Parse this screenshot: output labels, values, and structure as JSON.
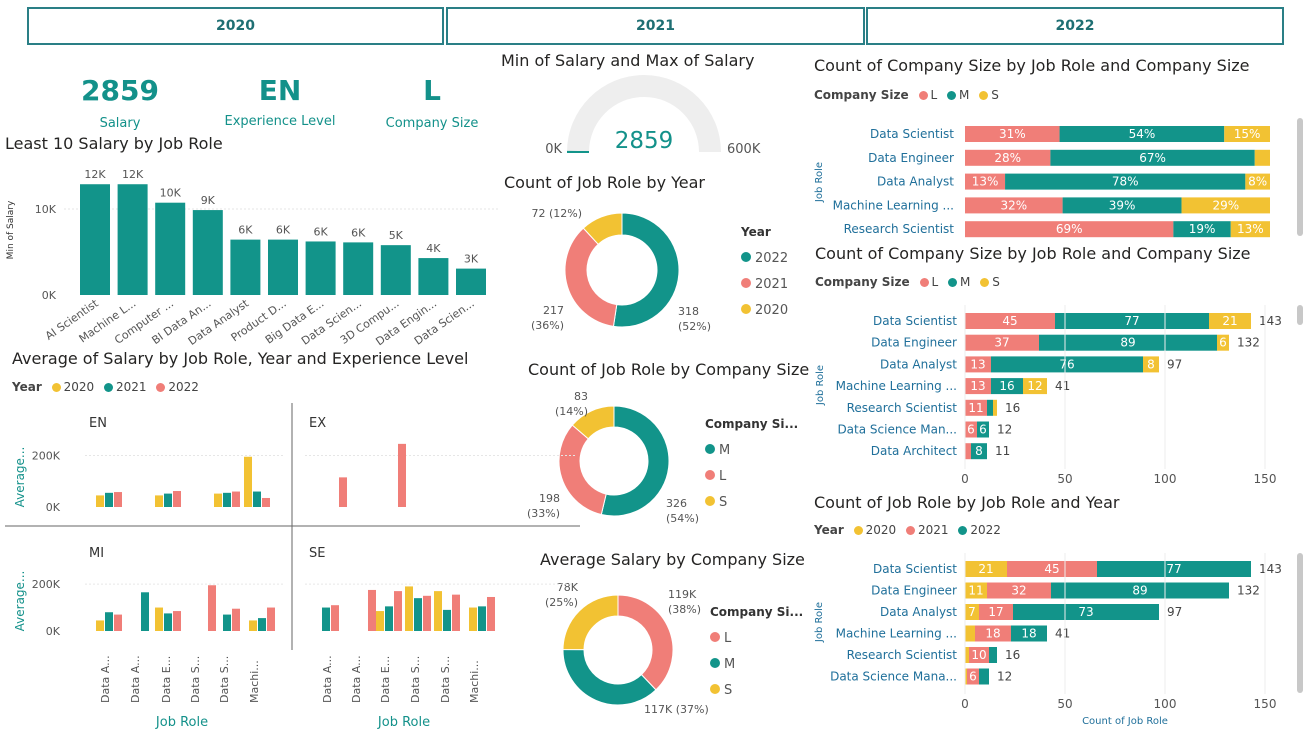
{
  "slicer": {
    "years": [
      "2020",
      "2021",
      "2022"
    ]
  },
  "colors": {
    "teal": "#12948a",
    "salmon": "#f07e78",
    "yellow": "#f2c233"
  },
  "cards": [
    {
      "value": "2859",
      "label": "Salary"
    },
    {
      "value": "EN",
      "label": "Experience Level"
    },
    {
      "value": "L",
      "label": "Company Size"
    }
  ],
  "charts": {
    "least10": {
      "title": "Least 10 Salary by Job Role",
      "ylabel": "Min of Salary"
    },
    "gauge": {
      "title": "Min of Salary and Max of Salary",
      "value": "2859",
      "min": "0K",
      "max": "600K"
    },
    "donut_year": {
      "title": "Count of Job Role by Year",
      "legend_title": "Year"
    },
    "donut_size": {
      "title": "Count of Job Role by Company Size",
      "legend_title": "Company Si..."
    },
    "donut_avg": {
      "title": "Average Salary by Company Size",
      "legend_title": "Company Si..."
    },
    "avg_matrix": {
      "title": "Average of Salary by Job Role, Year and Experience Level",
      "legend_title": "Year",
      "xlabel": "Job Role",
      "ylabel": "Average..."
    },
    "stack100": {
      "title": "Count of Company Size by Job Role and Company Size",
      "legend_title": "Company Size",
      "ylabel": "Job Role"
    },
    "stack_count": {
      "title": "Count of Company Size by Job Role and Company Size",
      "legend_title": "Company Size",
      "ylabel": "Job Role"
    },
    "stack_year": {
      "title": "Count of Job Role by Job Role and Year",
      "legend_title": "Year",
      "ylabel": "Job Role",
      "xlabel": "Count of Job Role"
    }
  },
  "chart_data": [
    {
      "type": "bar",
      "id": "least10",
      "title": "Least 10 Salary by Job Role",
      "ylabel": "Min of Salary",
      "ylim": [
        0,
        13000
      ],
      "yticks": [
        "0K",
        "10K"
      ],
      "categories": [
        "AI Scientist",
        "Machine L...",
        "Computer ...",
        "BI Data An...",
        "Data Analyst",
        "Product D...",
        "Big Data E...",
        "Data Scien...",
        "3D Compu...",
        "Data Engin...",
        "Data Scien..."
      ],
      "values": [
        12000,
        12000,
        10000,
        9200,
        6000,
        6000,
        5800,
        5700,
        5400,
        4000,
        2859
      ],
      "labels": [
        "12K",
        "12K",
        "10K",
        "9K",
        "6K",
        "6K",
        "6K",
        "6K",
        "5K",
        "4K",
        "3K"
      ]
    },
    {
      "type": "gauge",
      "id": "gauge",
      "value": 2859,
      "min": 0,
      "max": 600000
    },
    {
      "type": "pie",
      "id": "donut_year",
      "categories": [
        "2022",
        "2021",
        "2020"
      ],
      "values": [
        318,
        217,
        72
      ],
      "labels": [
        "318\n(52%)",
        "217\n(36%)",
        "72 (12%)"
      ]
    },
    {
      "type": "pie",
      "id": "donut_size",
      "categories": [
        "M",
        "L",
        "S"
      ],
      "values": [
        326,
        198,
        83
      ],
      "labels": [
        "326\n(54%)",
        "198\n(33%)",
        "83\n(14%)"
      ]
    },
    {
      "type": "pie",
      "id": "donut_avg",
      "categories": [
        "L",
        "M",
        "S"
      ],
      "values": [
        119,
        117,
        78
      ],
      "labels": [
        "119K\n(38%)",
        "117K (37%)",
        "78K\n(25%)"
      ]
    },
    {
      "type": "bar",
      "id": "stack100",
      "orientation": "horizontal",
      "stacked": "percent",
      "series_names": [
        "L",
        "M",
        "S"
      ],
      "categories": [
        "Data Scientist",
        "Data Engineer",
        "Data Analyst",
        "Machine Learning ...",
        "Research Scientist"
      ],
      "values": [
        [
          31,
          54,
          15
        ],
        [
          28,
          67,
          5
        ],
        [
          13,
          78,
          8
        ],
        [
          32,
          39,
          29
        ],
        [
          69,
          19,
          13
        ]
      ],
      "labels": [
        [
          "31%",
          "54%",
          "15%"
        ],
        [
          "28%",
          "67%",
          ""
        ],
        [
          "13%",
          "78%",
          "8%"
        ],
        [
          "32%",
          "39%",
          "29%"
        ],
        [
          "69%",
          "19%",
          "13%"
        ]
      ]
    },
    {
      "type": "bar",
      "id": "stack_count",
      "orientation": "horizontal",
      "stacked": "count",
      "series_names": [
        "L",
        "M",
        "S"
      ],
      "categories": [
        "Data Scientist",
        "Data Engineer",
        "Data Analyst",
        "Machine Learning ...",
        "Research Scientist",
        "Data Science Man...",
        "Data Architect"
      ],
      "values": [
        [
          45,
          77,
          21
        ],
        [
          37,
          89,
          6
        ],
        [
          13,
          76,
          8
        ],
        [
          13,
          16,
          12
        ],
        [
          11,
          3,
          2
        ],
        [
          6,
          6,
          0
        ],
        [
          3,
          8,
          0
        ]
      ],
      "labels": [
        [
          "45",
          "77",
          "21"
        ],
        [
          "37",
          "89",
          "6"
        ],
        [
          "13",
          "76",
          "8"
        ],
        [
          "13",
          "16",
          "12"
        ],
        [
          "11",
          "",
          ""
        ],
        [
          "6",
          "6",
          ""
        ],
        [
          "",
          "8",
          ""
        ]
      ],
      "totals": [
        143,
        132,
        97,
        41,
        16,
        12,
        11
      ],
      "xlim": [
        0,
        150
      ],
      "xticks": [
        0,
        50,
        100,
        150
      ]
    },
    {
      "type": "bar",
      "id": "stack_year",
      "orientation": "horizontal",
      "stacked": "count",
      "series_names": [
        "2020",
        "2021",
        "2022"
      ],
      "xlabel": "Count of Job Role",
      "categories": [
        "Data Scientist",
        "Data Engineer",
        "Data Analyst",
        "Machine Learning ...",
        "Research Scientist",
        "Data Science Mana..."
      ],
      "values": [
        [
          21,
          45,
          77
        ],
        [
          11,
          32,
          89
        ],
        [
          7,
          17,
          73
        ],
        [
          5,
          18,
          18
        ],
        [
          2,
          10,
          4
        ],
        [
          1,
          6,
          5
        ]
      ],
      "labels": [
        [
          "21",
          "45",
          "77"
        ],
        [
          "11",
          "32",
          "89"
        ],
        [
          "7",
          "17",
          "73"
        ],
        [
          "",
          "18",
          "18"
        ],
        [
          "",
          "10",
          ""
        ],
        [
          "",
          "6",
          ""
        ]
      ],
      "totals": [
        143,
        132,
        97,
        41,
        16,
        12
      ],
      "xlim": [
        0,
        150
      ],
      "xticks": [
        0,
        50,
        100,
        150
      ]
    },
    {
      "type": "bar",
      "id": "avg_matrix",
      "series_names": [
        "2020",
        "2021",
        "2022"
      ],
      "yticks": [
        "0K",
        "200K"
      ],
      "ylim": [
        0,
        260000
      ],
      "panels": [
        {
          "name": "EN",
          "groups": [
            [
              45000,
              55000,
              58000
            ],
            [
              45000,
              52000,
              62000
            ],
            [
              52000,
              55000,
              60000
            ],
            [
              195000,
              60000,
              35000
            ]
          ]
        },
        {
          "name": "EX",
          "groups": [
            [
              0,
              0,
              115000
            ],
            [
              0,
              0,
              245000
            ]
          ]
        },
        {
          "name": "MI",
          "groups": [
            [
              45000,
              80000,
              70000
            ],
            [
              0,
              165000,
              0
            ],
            [
              100000,
              75000,
              85000
            ],
            [
              0,
              0,
              195000
            ],
            [
              0,
              70000,
              95000
            ],
            [
              45000,
              55000,
              100000
            ]
          ]
        },
        {
          "name": "SE",
          "groups": [
            [
              0,
              100000,
              110000
            ],
            [
              0,
              0,
              175000
            ],
            [
              85000,
              105000,
              170000
            ],
            [
              190000,
              140000,
              150000
            ],
            [
              170000,
              90000,
              155000
            ],
            [
              100000,
              105000,
              145000
            ]
          ]
        }
      ],
      "xcategories_left": [
        "Data A...",
        "Data A...",
        "Data E...",
        "Data S...",
        "Data S...",
        "Machi..."
      ],
      "xcategories_right": [
        "Data A...",
        "Data A...",
        "Data E...",
        "Data S...",
        "Data S...",
        "Machi..."
      ]
    }
  ]
}
